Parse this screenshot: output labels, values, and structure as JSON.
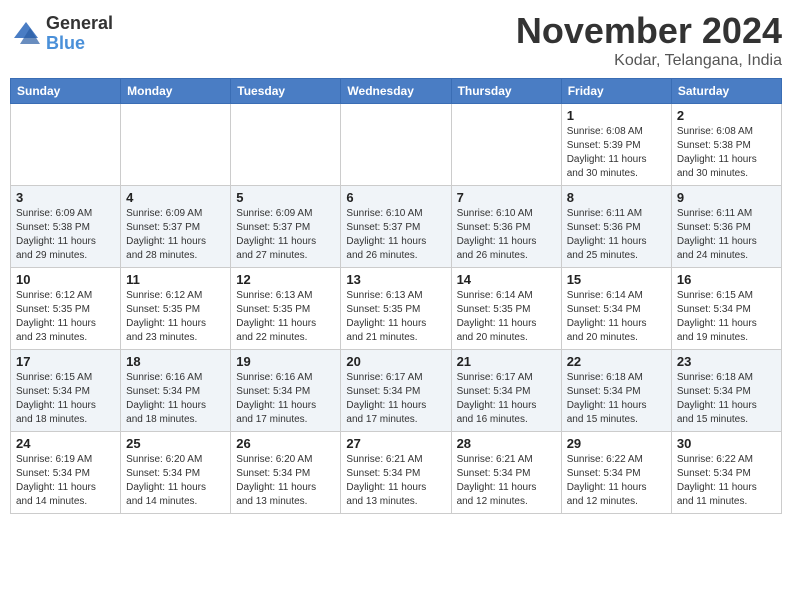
{
  "logo": {
    "general": "General",
    "blue": "Blue"
  },
  "title": "November 2024",
  "subtitle": "Kodar, Telangana, India",
  "headers": [
    "Sunday",
    "Monday",
    "Tuesday",
    "Wednesday",
    "Thursday",
    "Friday",
    "Saturday"
  ],
  "weeks": [
    [
      {
        "day": "",
        "info": ""
      },
      {
        "day": "",
        "info": ""
      },
      {
        "day": "",
        "info": ""
      },
      {
        "day": "",
        "info": ""
      },
      {
        "day": "",
        "info": ""
      },
      {
        "day": "1",
        "info": "Sunrise: 6:08 AM\nSunset: 5:39 PM\nDaylight: 11 hours and 30 minutes."
      },
      {
        "day": "2",
        "info": "Sunrise: 6:08 AM\nSunset: 5:38 PM\nDaylight: 11 hours and 30 minutes."
      }
    ],
    [
      {
        "day": "3",
        "info": "Sunrise: 6:09 AM\nSunset: 5:38 PM\nDaylight: 11 hours and 29 minutes."
      },
      {
        "day": "4",
        "info": "Sunrise: 6:09 AM\nSunset: 5:37 PM\nDaylight: 11 hours and 28 minutes."
      },
      {
        "day": "5",
        "info": "Sunrise: 6:09 AM\nSunset: 5:37 PM\nDaylight: 11 hours and 27 minutes."
      },
      {
        "day": "6",
        "info": "Sunrise: 6:10 AM\nSunset: 5:37 PM\nDaylight: 11 hours and 26 minutes."
      },
      {
        "day": "7",
        "info": "Sunrise: 6:10 AM\nSunset: 5:36 PM\nDaylight: 11 hours and 26 minutes."
      },
      {
        "day": "8",
        "info": "Sunrise: 6:11 AM\nSunset: 5:36 PM\nDaylight: 11 hours and 25 minutes."
      },
      {
        "day": "9",
        "info": "Sunrise: 6:11 AM\nSunset: 5:36 PM\nDaylight: 11 hours and 24 minutes."
      }
    ],
    [
      {
        "day": "10",
        "info": "Sunrise: 6:12 AM\nSunset: 5:35 PM\nDaylight: 11 hours and 23 minutes."
      },
      {
        "day": "11",
        "info": "Sunrise: 6:12 AM\nSunset: 5:35 PM\nDaylight: 11 hours and 23 minutes."
      },
      {
        "day": "12",
        "info": "Sunrise: 6:13 AM\nSunset: 5:35 PM\nDaylight: 11 hours and 22 minutes."
      },
      {
        "day": "13",
        "info": "Sunrise: 6:13 AM\nSunset: 5:35 PM\nDaylight: 11 hours and 21 minutes."
      },
      {
        "day": "14",
        "info": "Sunrise: 6:14 AM\nSunset: 5:35 PM\nDaylight: 11 hours and 20 minutes."
      },
      {
        "day": "15",
        "info": "Sunrise: 6:14 AM\nSunset: 5:34 PM\nDaylight: 11 hours and 20 minutes."
      },
      {
        "day": "16",
        "info": "Sunrise: 6:15 AM\nSunset: 5:34 PM\nDaylight: 11 hours and 19 minutes."
      }
    ],
    [
      {
        "day": "17",
        "info": "Sunrise: 6:15 AM\nSunset: 5:34 PM\nDaylight: 11 hours and 18 minutes."
      },
      {
        "day": "18",
        "info": "Sunrise: 6:16 AM\nSunset: 5:34 PM\nDaylight: 11 hours and 18 minutes."
      },
      {
        "day": "19",
        "info": "Sunrise: 6:16 AM\nSunset: 5:34 PM\nDaylight: 11 hours and 17 minutes."
      },
      {
        "day": "20",
        "info": "Sunrise: 6:17 AM\nSunset: 5:34 PM\nDaylight: 11 hours and 17 minutes."
      },
      {
        "day": "21",
        "info": "Sunrise: 6:17 AM\nSunset: 5:34 PM\nDaylight: 11 hours and 16 minutes."
      },
      {
        "day": "22",
        "info": "Sunrise: 6:18 AM\nSunset: 5:34 PM\nDaylight: 11 hours and 15 minutes."
      },
      {
        "day": "23",
        "info": "Sunrise: 6:18 AM\nSunset: 5:34 PM\nDaylight: 11 hours and 15 minutes."
      }
    ],
    [
      {
        "day": "24",
        "info": "Sunrise: 6:19 AM\nSunset: 5:34 PM\nDaylight: 11 hours and 14 minutes."
      },
      {
        "day": "25",
        "info": "Sunrise: 6:20 AM\nSunset: 5:34 PM\nDaylight: 11 hours and 14 minutes."
      },
      {
        "day": "26",
        "info": "Sunrise: 6:20 AM\nSunset: 5:34 PM\nDaylight: 11 hours and 13 minutes."
      },
      {
        "day": "27",
        "info": "Sunrise: 6:21 AM\nSunset: 5:34 PM\nDaylight: 11 hours and 13 minutes."
      },
      {
        "day": "28",
        "info": "Sunrise: 6:21 AM\nSunset: 5:34 PM\nDaylight: 11 hours and 12 minutes."
      },
      {
        "day": "29",
        "info": "Sunrise: 6:22 AM\nSunset: 5:34 PM\nDaylight: 11 hours and 12 minutes."
      },
      {
        "day": "30",
        "info": "Sunrise: 6:22 AM\nSunset: 5:34 PM\nDaylight: 11 hours and 11 minutes."
      }
    ]
  ]
}
